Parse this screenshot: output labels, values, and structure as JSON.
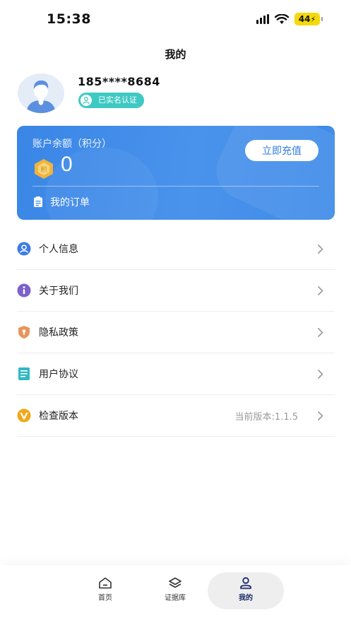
{
  "status_bar": {
    "time": "15:38",
    "battery": "44"
  },
  "header": {
    "title": "我的"
  },
  "profile": {
    "phone": "185****8684",
    "verified_label": "已实名认证"
  },
  "balance_card": {
    "label": "账户余额（积分）",
    "value": "0",
    "recharge_label": "立即充值",
    "orders_label": "我的订单"
  },
  "menu": {
    "items": [
      {
        "label": "个人信息",
        "icon": "user-circle-icon",
        "color": "#3b7ce6"
      },
      {
        "label": "关于我们",
        "icon": "info-icon",
        "color": "#7b61c9"
      },
      {
        "label": "隐私政策",
        "icon": "shield-icon",
        "color": "#e8955b"
      },
      {
        "label": "用户协议",
        "icon": "document-icon",
        "color": "#2fb8c4"
      },
      {
        "label": "检查版本",
        "icon": "version-icon",
        "color": "#f0a81c",
        "value": "当前版本:1.1.5"
      }
    ]
  },
  "tab_bar": {
    "tabs": [
      {
        "label": "首页",
        "icon": "home-icon"
      },
      {
        "label": "证据库",
        "icon": "layers-icon"
      },
      {
        "label": "我的",
        "icon": "user-icon",
        "active": true
      }
    ]
  },
  "colors": {
    "accent": "#3a86e6",
    "verified": "#3ec9c3"
  }
}
